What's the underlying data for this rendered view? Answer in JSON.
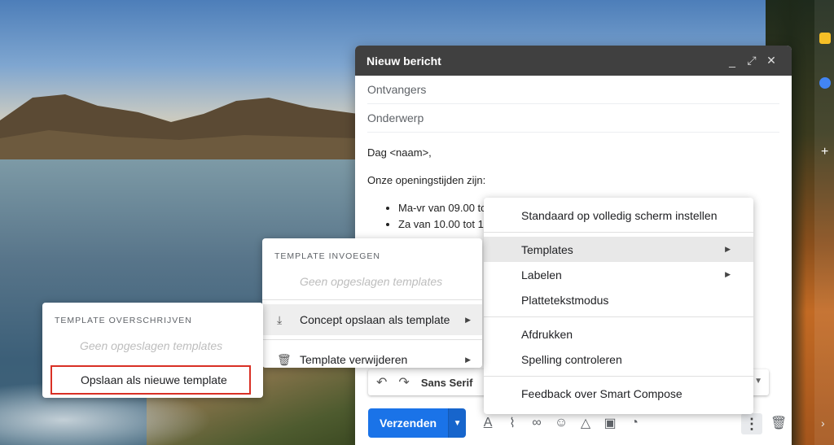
{
  "compose": {
    "title": "Nieuw bericht",
    "recipients_placeholder": "Ontvangers",
    "subject_placeholder": "Onderwerp",
    "body": {
      "greeting": "Dag <naam>,",
      "intro": "Onze openingstijden zijn:",
      "list": [
        "Ma-vr van 09.00 tot",
        "Za van 10.00 tot 1"
      ]
    },
    "format_bar": {
      "font": "Sans Serif"
    },
    "send_label": "Verzenden"
  },
  "main_menu": {
    "items": [
      "Standaard op volledig scherm instellen",
      "Templates",
      "Labelen",
      "Platteteks​tmodus",
      "Afdrukken",
      "Spelling controleren",
      "Feedback over Smart Compose"
    ],
    "highlighted": "Templates"
  },
  "template_menu": {
    "heading": "TEMPLATE INVOEGEN",
    "empty": "Geen opgeslagen templates",
    "save_draft": "Concept opslaan als template",
    "delete": "Template verwijderen"
  },
  "overwrite_menu": {
    "heading": "TEMPLATE OVERSCHRIJVEN",
    "empty": "Geen opgeslagen templates",
    "save_new": "Opslaan als nieuwe template"
  },
  "colors": {
    "send_button": "#1a73e8",
    "highlight_box": "#d93025",
    "compose_header": "#404040"
  }
}
